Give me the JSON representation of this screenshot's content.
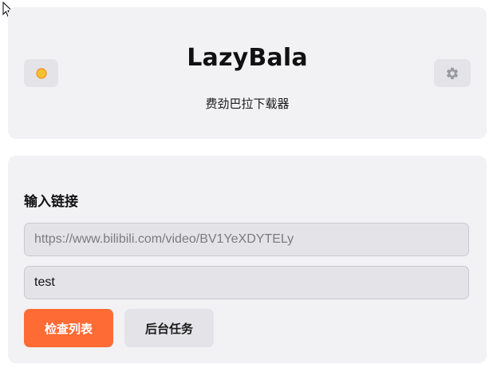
{
  "header": {
    "title": "LazyBala",
    "subtitle": "费劲巴拉下载器",
    "theme_icon": "sun-icon",
    "settings_icon": "gear-icon"
  },
  "input_section": {
    "title": "输入链接",
    "url_placeholder": "https://www.bilibili.com/video/BV1YeXDYTELy",
    "url_value": "",
    "name_value": "test"
  },
  "buttons": {
    "check_list_label": "检查列表",
    "background_tasks_label": "后台任务"
  },
  "colors": {
    "accent": "#fe6b35",
    "card_bg": "#f2f2f5",
    "button_bg": "#e4e4e8",
    "sun": "#f6c231",
    "gear": "#9a9aa3"
  }
}
